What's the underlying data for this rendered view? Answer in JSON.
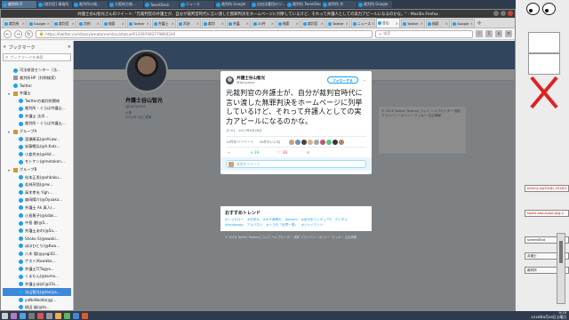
{
  "window_title": "弁護士谷山智光さんのツイート: \"元裁判官の弁護士が、自分が裁判官時代に言い渡した無罪判決をホームページに列挙しているけど、それって弁護人としての実力アピールになるのかな。\" - Mozilla Firefox",
  "taskbar": {
    "tasks": [
      "裁判所 Fi",
      "[裁判官] 事務所",
      "裁判所の検...",
      "大阪地方裁...",
      "TweetDeck",
      "ニュース",
      "裁判所 Google",
      "自由法曹団のツ...",
      "裁判所 TweetDeck",
      "裁判所 弁",
      "裁判所 Google"
    ],
    "active_index": 0
  },
  "browser": {
    "tabs": [
      "裁判所",
      "Google",
      "裁判官",
      "判例",
      "検索",
      "Twitter",
      "弁護士",
      "判決",
      "裁判",
      "弁護",
      "20件",
      "検索",
      "裁判官",
      "Twitter",
      "ニュース",
      "谷山",
      "Twitter",
      "検索",
      "Google"
    ],
    "active_tab_index": 15,
    "url": "https://twitter.com/taniyamatomomitsu/status/913397493779860240",
    "search_placeholder": "検索",
    "back": "←",
    "forward": "→",
    "reload": "↻",
    "tb_icons": [
      "☆",
      "⇩",
      "⌂",
      "≡"
    ]
  },
  "sidebar": {
    "header": "ブックマーク",
    "search_placeholder": "ブックマークを検索",
    "items": [
      {
        "label": "司法修習センター（法...",
        "icon": "tw",
        "indent": 1
      },
      {
        "label": "裁判所HP（判例検索）",
        "icon": "gy",
        "indent": 1
      },
      {
        "label": "Twitter",
        "icon": "tw",
        "indent": 1
      },
      {
        "label": "弁護士",
        "icon": "fd",
        "indent": 1,
        "arrow": "▾"
      },
      {
        "label": "Twitterの裁判所関係",
        "icon": "tw",
        "indent": 2
      },
      {
        "label": "裁判所・ぐらば弁護士...",
        "icon": "tw",
        "indent": 2
      },
      {
        "label": "弁護士 法学...",
        "icon": "tw",
        "indent": 2
      },
      {
        "label": "裁判所・ぐらば弁護士...",
        "icon": "tw",
        "indent": 2
      },
      {
        "label": "グループA",
        "icon": "fd",
        "indent": 1,
        "arrow": "▾"
      },
      {
        "label": "渡瀬康英(@shLaw...",
        "icon": "tw",
        "indent": 2
      },
      {
        "label": "安藤暢弘(@h.Kats...",
        "icon": "tw",
        "indent": 2
      },
      {
        "label": "小倉秀夫(@Hid...",
        "icon": "tw",
        "indent": 2
      },
      {
        "label": "モトケン(@motoken...",
        "icon": "tw",
        "indent": 2
      },
      {
        "label": "グループB",
        "icon": "fd",
        "indent": 1,
        "arrow": "▾"
      },
      {
        "label": "松本正男(@ohbaku...",
        "icon": "tw",
        "indent": 2
      },
      {
        "label": "若林亮悟(@rw...",
        "icon": "tw",
        "indent": 2
      },
      {
        "label": "高木孝夫 Yigh...",
        "icon": "tw",
        "indent": 2
      },
      {
        "label": "森岡陽介(@Oyaaka...",
        "icon": "tw",
        "indent": 2
      },
      {
        "label": "弁護士 Ak 真人(...",
        "icon": "tw",
        "indent": 2
      },
      {
        "label": "小島篤子(@kdak...",
        "icon": "tw",
        "indent": 2
      },
      {
        "label": "中島 健(@5...",
        "icon": "tw",
        "indent": 2
      },
      {
        "label": "弁護士あの(@5a...",
        "icon": "tw",
        "indent": 2
      },
      {
        "label": "Shoko S(@awaki...",
        "icon": "tw",
        "indent": 2
      },
      {
        "label": "ほぼひとり(@Kwa...",
        "icon": "tw",
        "indent": 2
      },
      {
        "label": "八木 陽(@yagi02...",
        "icon": "tw",
        "indent": 2
      },
      {
        "label": "ゲスト(Kuwaba...",
        "icon": "tw",
        "indent": 2
      },
      {
        "label": "弁護士T(Tagyo...",
        "icon": "tw",
        "indent": 2
      },
      {
        "label": "くまもん(@kumo...",
        "icon": "tw",
        "indent": 2
      },
      {
        "label": "弁護士ほぼ(@15s...",
        "icon": "tw",
        "indent": 2
      },
      {
        "label": "谷山智光(@taniya...",
        "icon": "tw",
        "indent": 2,
        "selected": true
      },
      {
        "label": "yaNoNaoKo(@J...",
        "icon": "tw",
        "indent": 2
      },
      {
        "label": "紙田 誠(@ta...",
        "icon": "tw",
        "indent": 2
      },
      {
        "label": "桜井東(@ku...",
        "icon": "tw",
        "indent": 2
      },
      {
        "label": "凛 和宏(@NM...",
        "icon": "tw",
        "indent": 2
      }
    ]
  },
  "profile": {
    "name": "弁護士谷山智光",
    "handle": "@taniyama",
    "location": "大阪",
    "joined": "2010年7月に登録"
  },
  "tweet": {
    "author_name": "弁護士谷山智光",
    "author_handle": "@taniyama",
    "follow_label": "フォローする",
    "text": "元裁判官の弁護士が、自分が裁判官時代に言い渡した無罪判決をホームページに列挙しているけど、それって弁護人としての実力アピールになるのかな。",
    "timestamp": "15:01 - 2017年9月28日",
    "retweets_label": "19件のリツイート",
    "likes_label": "30件のいいね",
    "actions": [
      "↩",
      "⟲ 19",
      "♡ 30",
      "✉"
    ],
    "reply_placeholder": "返信をツイート",
    "face_colors": [
      "#c9a27f",
      "#7a8fb0",
      "#444444",
      "#d9b08c",
      "#9aa",
      "#b57",
      "#5c7",
      "#333",
      "#a86"
    ]
  },
  "trends": {
    "title": "おすすめトレンド",
    "items": [
      "#トゥモロー",
      "#中央大",
      "#ポチ頑張れ",
      "bokashi",
      "#全日本フィギュア4",
      "デジタル",
      "#fanbaseJp",
      "アルバネイ",
      "#トヨタ「世界一周」",
      "#ジャイアンツ"
    ]
  },
  "footer_text": "© 2018 Twitter  Twitterについて  ヘルプセンター  規約  プライバシーポリシー  クッキー  広告情報",
  "right_card_text": "© 2018 Twitter  Twitterについて ヘルプセンター 規約 プライバシーポリシー クッキー 広告情報",
  "desktop": {
    "notes": [
      "tommy-wp2018y 2018/1",
      "tweet-add-eyepi-pkg-2",
      "screenShot",
      "弁護士",
      "裁判所"
    ]
  },
  "clock": {
    "time": "9:19",
    "date": "2018年9月28日土曜日"
  },
  "colors": {
    "twitter_blue": "#1da1f2",
    "taskbar": "#2d3b4d",
    "selected": "#3d88d8"
  }
}
